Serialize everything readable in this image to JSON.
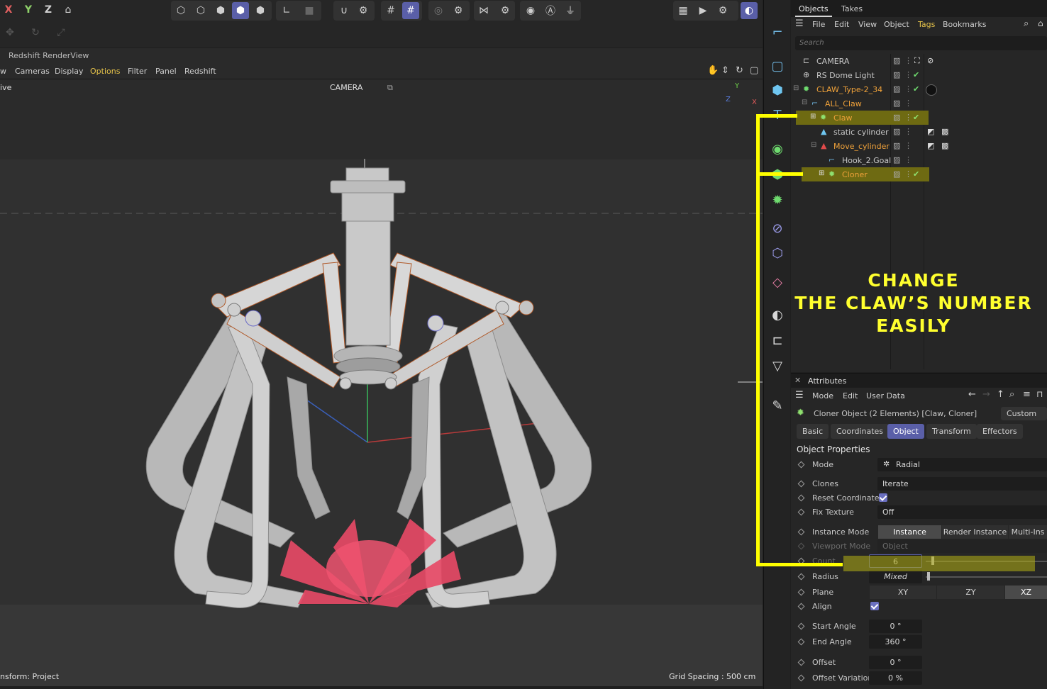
{
  "toolbar": {
    "axis_x": "X",
    "axis_y": "Y",
    "axis_z": "Z"
  },
  "viewport": {
    "panel_title": "Redshift RenderView",
    "menu": [
      {
        "label": "w",
        "active": false
      },
      {
        "label": "Cameras",
        "active": false
      },
      {
        "label": "Display",
        "active": false
      },
      {
        "label": "Options",
        "active": true
      },
      {
        "label": "Filter",
        "active": false
      },
      {
        "label": "Panel",
        "active": false
      },
      {
        "label": "Redshift",
        "active": false
      }
    ],
    "mode_label": "ive",
    "camera_label": "CAMERA",
    "status_left": "nsform: Project",
    "grid_spacing": "Grid Spacing : 500 cm",
    "axis_gizmo": {
      "y": "Y",
      "z": "Z",
      "x": "X"
    }
  },
  "object_manager": {
    "tabs": [
      "Objects",
      "Takes"
    ],
    "menu": [
      {
        "label": "File",
        "active": false
      },
      {
        "label": "Edit",
        "active": false
      },
      {
        "label": "View",
        "active": false
      },
      {
        "label": "Object",
        "active": false
      },
      {
        "label": "Tags",
        "active": true
      },
      {
        "label": "Bookmarks",
        "active": false
      }
    ],
    "search_placeholder": "Search",
    "objects": [
      {
        "name": "CAMERA",
        "color": "#d8d8d8"
      },
      {
        "name": "RS Dome Light",
        "color": "#d8d8d8"
      },
      {
        "name": "CLAW_Type-2_34",
        "color": "#f0a23a"
      },
      {
        "name": "ALL_Claw",
        "color": "#f0a23a"
      },
      {
        "name": "Claw",
        "color": "#f0a23a"
      },
      {
        "name": "static cylinder",
        "color": "#d8d8d8"
      },
      {
        "name": "Move_cylinder",
        "color": "#f0a23a"
      },
      {
        "name": "Hook_2.Goal",
        "color": "#d8d8d8"
      },
      {
        "name": "Cloner",
        "color": "#f0a23a"
      }
    ]
  },
  "attributes": {
    "title": "Attributes",
    "menu": [
      "Mode",
      "Edit",
      "User Data"
    ],
    "object_line": "Cloner Object (2 Elements) [Claw, Cloner]",
    "custom_button": "Custom",
    "tabs": [
      {
        "label": "Basic",
        "active": false
      },
      {
        "label": "Coordinates",
        "active": false
      },
      {
        "label": "Object",
        "active": true
      },
      {
        "label": "Transform",
        "active": false
      },
      {
        "label": "Effectors",
        "active": false
      }
    ],
    "section": "Object Properties",
    "mode_label": "Mode",
    "mode_value": "Radial",
    "clones_label": "Clones",
    "clones_value": "Iterate",
    "reset_coords_label": "Reset Coordinates",
    "fix_texture_label": "Fix Texture",
    "fix_texture_value": "Off",
    "instance_mode_label": "Instance Mode",
    "instance_mode_options": [
      "Instance",
      "Render Instance",
      "Multi-Ins"
    ],
    "viewport_mode_label": "Viewport Mode",
    "viewport_mode_value": "Object",
    "count_label": "Count",
    "count_value": "6",
    "radius_label": "Radius",
    "radius_value": "Mixed",
    "plane_label": "Plane",
    "plane_options": [
      "XY",
      "ZY",
      "XZ"
    ],
    "align_label": "Align",
    "start_angle_label": "Start Angle",
    "start_angle_value": "0 °",
    "end_angle_label": "End Angle",
    "end_angle_value": "360 °",
    "offset_label": "Offset",
    "offset_value": "0 °",
    "offset_variation_label": "Offset Variation",
    "offset_variation_value": "0 %"
  },
  "annotation": {
    "line1": "CHANGE",
    "line2": "THE CLAW’S NUMBER",
    "line3": "EASILY",
    "color": "#ffff00"
  }
}
